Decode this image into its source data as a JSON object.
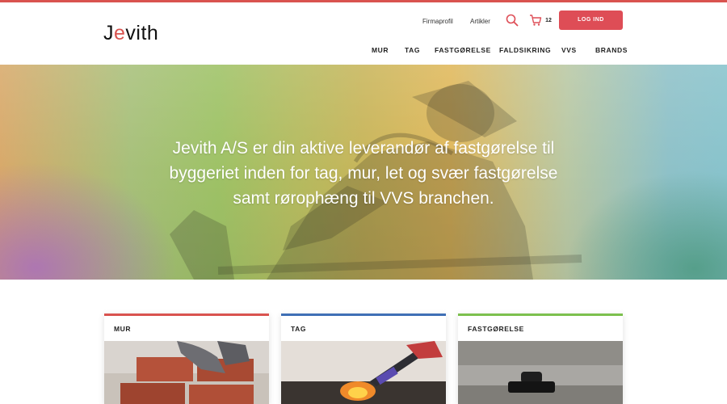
{
  "brand": {
    "logo_text_pre": "J",
    "logo_text_dot": "e",
    "logo_text_post": "vith",
    "accent": "#de4d56"
  },
  "utility": {
    "firmaprofil": "Firmaprofil",
    "artikler": "Artikler",
    "cart_count": "12",
    "login_label": "LOG IND"
  },
  "nav": {
    "items": [
      "MUR",
      "TAG",
      "FASTGØRELSE",
      "FALDSIKRING",
      "VVS",
      "BRANDS"
    ]
  },
  "hero": {
    "line1": "Jevith A/S er din aktive leverandør af fastgørelse til",
    "line2": "byggeriet inden for tag, mur, let og svær fastgørelse",
    "line3": "samt rørophæng til VVS branchen."
  },
  "categories": [
    {
      "title": "MUR",
      "accent": "#d9534f"
    },
    {
      "title": "TAG",
      "accent": "#3f6fb5"
    },
    {
      "title": "FASTGØRELSE",
      "accent": "#7cc04e"
    }
  ],
  "icons": {
    "search": "search-icon",
    "cart": "cart-icon"
  }
}
